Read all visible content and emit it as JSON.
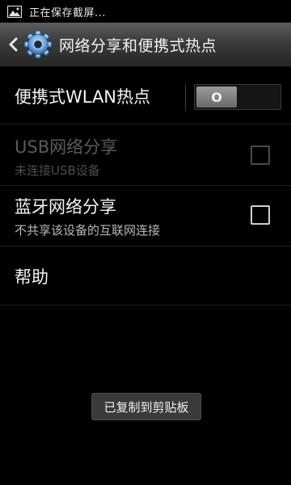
{
  "status_bar": {
    "notification_text": "正在保存截屏...",
    "icon": "image-icon"
  },
  "action_bar": {
    "back_icon": "chevron-left-icon",
    "app_icon": "settings-gear-icon",
    "title": "网络分享和便携式热点"
  },
  "settings": {
    "wlan_hotspot": {
      "label": "便携式WLAN热点",
      "switch_text": "O",
      "state": "off"
    },
    "usb_tethering": {
      "label": "USB网络分享",
      "sub": "未连接USB设备",
      "enabled": false,
      "checked": false
    },
    "bt_tethering": {
      "label": "蓝牙网络分享",
      "sub": "不共享该设备的互联网连接",
      "enabled": true,
      "checked": false
    },
    "help": {
      "label": "帮助"
    }
  },
  "toast": {
    "text": "已复制到剪贴板"
  },
  "colors": {
    "background": "#000000",
    "action_bar": "#3b3b3b",
    "disabled_text": "#5b5b5b"
  }
}
